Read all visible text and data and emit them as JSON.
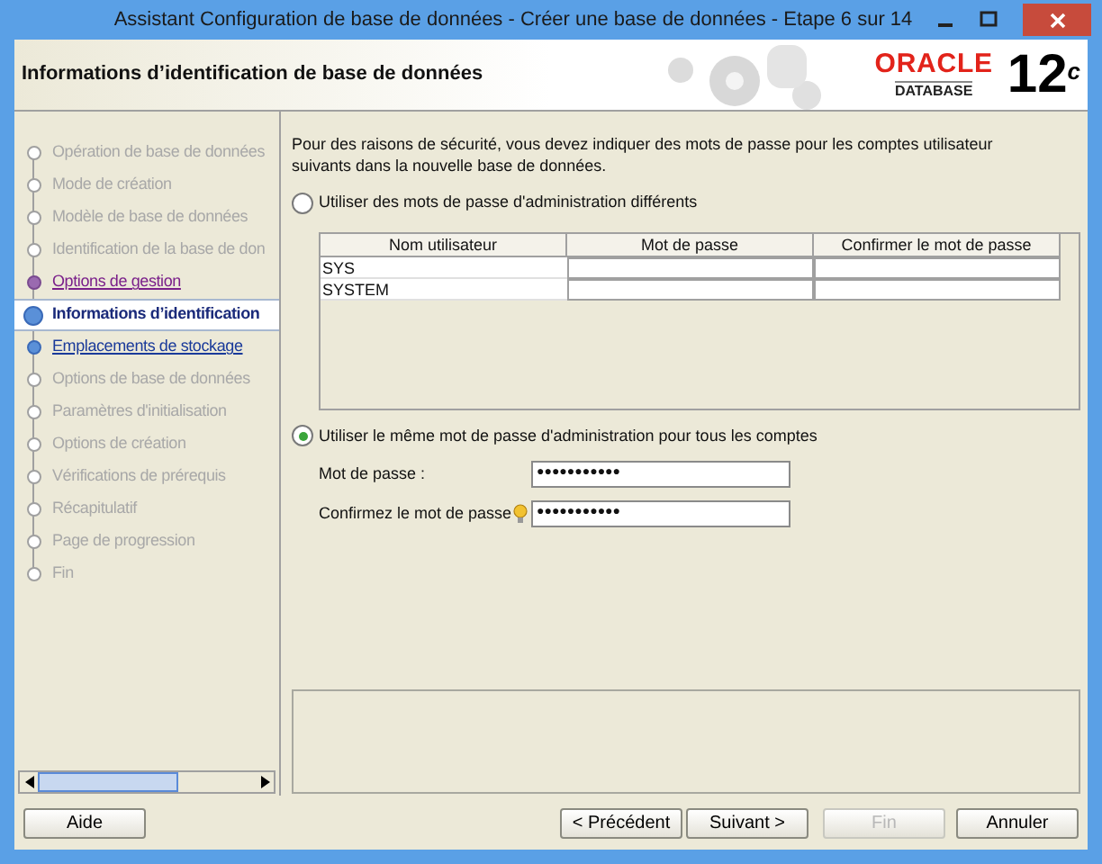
{
  "window": {
    "title": "Assistant Configuration de base de données - Créer une base de données - Etape 6 sur 14"
  },
  "header": {
    "title": "Informations d’identification de base de données",
    "logo_brand": "ORACLE",
    "logo_product": "DATABASE",
    "logo_version": "12",
    "logo_sup": "c"
  },
  "steps": [
    {
      "label": "Opération de base de données",
      "selected": false,
      "disabled": true,
      "visited": false
    },
    {
      "label": "Mode de création",
      "selected": false,
      "disabled": true,
      "visited": false
    },
    {
      "label": "Modèle de base de données",
      "selected": false,
      "disabled": true,
      "visited": false
    },
    {
      "label": "Identification de la base de don",
      "selected": false,
      "disabled": true,
      "visited": false
    },
    {
      "label": "Options de gestion",
      "selected": false,
      "disabled": false,
      "visited": true
    },
    {
      "label": "Informations d’identification",
      "selected": true,
      "disabled": false,
      "visited": false
    },
    {
      "label": "Emplacements de stockage",
      "selected": false,
      "disabled": false,
      "visited": false
    },
    {
      "label": "Options de base de données",
      "selected": false,
      "disabled": true,
      "visited": false
    },
    {
      "label": "Paramètres d'initialisation",
      "selected": false,
      "disabled": true,
      "visited": false
    },
    {
      "label": "Options de création",
      "selected": false,
      "disabled": true,
      "visited": false
    },
    {
      "label": "Vérifications de prérequis",
      "selected": false,
      "disabled": true,
      "visited": false
    },
    {
      "label": "Récapitulatif",
      "selected": false,
      "disabled": true,
      "visited": false
    },
    {
      "label": "Page de progression",
      "selected": false,
      "disabled": true,
      "visited": false
    },
    {
      "label": "Fin",
      "selected": false,
      "disabled": true,
      "visited": false
    }
  ],
  "intro": "Pour des raisons de sécurité, vous devez indiquer des mots de passe pour les comptes utilisateur suivants dans la nouvelle base de données.",
  "option_different": {
    "label": "Utiliser des mots de passe d'administration différents",
    "selected": false
  },
  "table": {
    "columns": [
      "Nom utilisateur",
      "Mot de passe",
      "Confirmer le mot de passe"
    ],
    "rows": [
      [
        "SYS"
      ],
      [
        "SYSTEM"
      ]
    ]
  },
  "option_same": {
    "label": "Utiliser le même mot de passe d'administration pour tous les comptes",
    "selected": true
  },
  "password": {
    "label": "Mot de passe :",
    "value": "●●●●●●●●●●●"
  },
  "confirm": {
    "label": "Confirmez le mot de passe",
    "value": "●●●●●●●●●●●"
  },
  "buttons": [
    {
      "label": "Aide",
      "disabled": false
    },
    {
      "label": "< Précédent",
      "disabled": false
    },
    {
      "label": "Suivant >",
      "disabled": false
    },
    {
      "label": "Fin",
      "disabled": true
    },
    {
      "label": "Annuler",
      "disabled": false
    }
  ]
}
